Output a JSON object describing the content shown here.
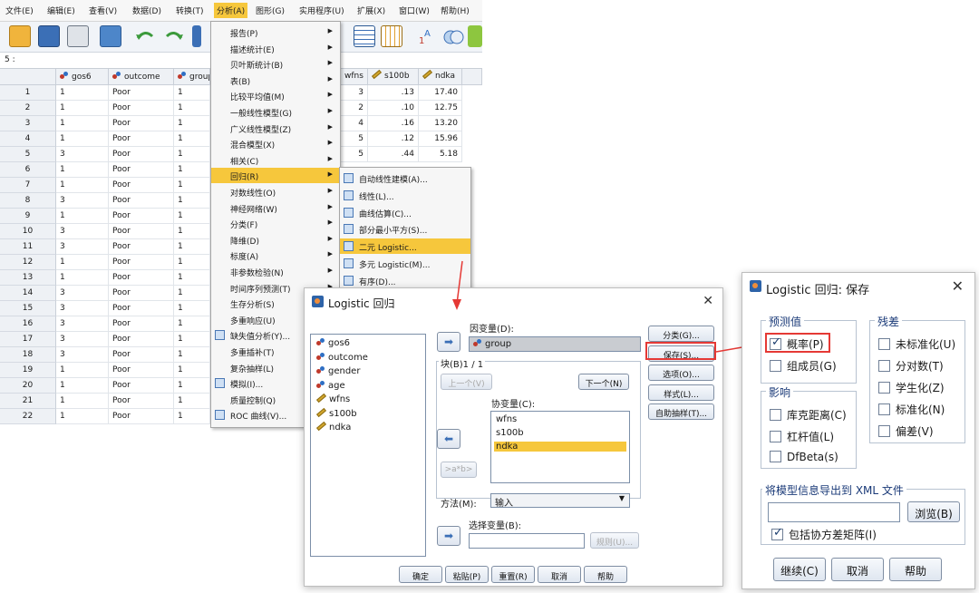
{
  "menubar": [
    "文件(E)",
    "编辑(E)",
    "查看(V)",
    "数据(D)",
    "转换(T)",
    "分析(A)",
    "图形(G)",
    "实用程序(U)",
    "扩展(X)",
    "窗口(W)",
    "帮助(H)"
  ],
  "active_menu": "分析(A)",
  "cell_ref": "5 :",
  "columns": [
    "gos6",
    "outcome",
    "group",
    "wfns",
    "s100b",
    "ndka"
  ],
  "rows": [
    {
      "n": "1",
      "gos6": "1",
      "outcome": "Poor",
      "group": "1",
      "wfns": "3",
      "s100b": ".13",
      "ndka": "17.40"
    },
    {
      "n": "2",
      "gos6": "1",
      "outcome": "Poor",
      "group": "1",
      "wfns": "2",
      "s100b": ".10",
      "ndka": "12.75"
    },
    {
      "n": "3",
      "gos6": "1",
      "outcome": "Poor",
      "group": "1",
      "wfns": "4",
      "s100b": ".16",
      "ndka": "13.20"
    },
    {
      "n": "4",
      "gos6": "1",
      "outcome": "Poor",
      "group": "1",
      "wfns": "5",
      "s100b": ".12",
      "ndka": "15.96"
    },
    {
      "n": "5",
      "gos6": "3",
      "outcome": "Poor",
      "group": "1",
      "wfns": "5",
      "s100b": ".44",
      "ndka": "5.18"
    },
    {
      "n": "6",
      "gos6": "1",
      "outcome": "Poor",
      "group": "1"
    },
    {
      "n": "7",
      "gos6": "1",
      "outcome": "Poor",
      "group": "1"
    },
    {
      "n": "8",
      "gos6": "3",
      "outcome": "Poor",
      "group": "1"
    },
    {
      "n": "9",
      "gos6": "1",
      "outcome": "Poor",
      "group": "1"
    },
    {
      "n": "10",
      "gos6": "3",
      "outcome": "Poor",
      "group": "1"
    },
    {
      "n": "11",
      "gos6": "3",
      "outcome": "Poor",
      "group": "1"
    },
    {
      "n": "12",
      "gos6": "1",
      "outcome": "Poor",
      "group": "1"
    },
    {
      "n": "13",
      "gos6": "1",
      "outcome": "Poor",
      "group": "1"
    },
    {
      "n": "14",
      "gos6": "3",
      "outcome": "Poor",
      "group": "1"
    },
    {
      "n": "15",
      "gos6": "3",
      "outcome": "Poor",
      "group": "1"
    },
    {
      "n": "16",
      "gos6": "3",
      "outcome": "Poor",
      "group": "1"
    },
    {
      "n": "17",
      "gos6": "3",
      "outcome": "Poor",
      "group": "1"
    },
    {
      "n": "18",
      "gos6": "3",
      "outcome": "Poor",
      "group": "1"
    },
    {
      "n": "19",
      "gos6": "1",
      "outcome": "Poor",
      "group": "1"
    },
    {
      "n": "20",
      "gos6": "1",
      "outcome": "Poor",
      "group": "1"
    },
    {
      "n": "21",
      "gos6": "1",
      "outcome": "Poor",
      "group": "1"
    },
    {
      "n": "22",
      "gos6": "1",
      "outcome": "Poor",
      "group": "1"
    }
  ],
  "analyze_menu": [
    {
      "label": "报告(P)",
      "sub": true
    },
    {
      "label": "描述统计(E)",
      "sub": true
    },
    {
      "label": "贝叶斯统计(B)",
      "sub": true
    },
    {
      "label": "表(B)",
      "sub": true
    },
    {
      "label": "比较平均值(M)",
      "sub": true
    },
    {
      "label": "一般线性模型(G)",
      "sub": true
    },
    {
      "label": "广义线性模型(Z)",
      "sub": true
    },
    {
      "label": "混合模型(X)",
      "sub": true
    },
    {
      "label": "相关(C)",
      "sub": true
    },
    {
      "label": "回归(R)",
      "sub": true,
      "highlight": true
    },
    {
      "label": "对数线性(O)",
      "sub": true
    },
    {
      "label": "神经网络(W)",
      "sub": true
    },
    {
      "label": "分类(F)",
      "sub": true
    },
    {
      "label": "降维(D)",
      "sub": true
    },
    {
      "label": "标度(A)",
      "sub": true
    },
    {
      "label": "非参数检验(N)",
      "sub": true
    },
    {
      "label": "时间序列预测(T)",
      "sub": true
    },
    {
      "label": "生存分析(S)",
      "sub": true
    },
    {
      "label": "多重响应(U)",
      "sub": true
    },
    {
      "label": "缺失值分析(Y)...",
      "icon": true
    },
    {
      "label": "多重插补(T)",
      "sub": true
    },
    {
      "label": "复杂抽样(L)",
      "sub": true
    },
    {
      "label": "模拟(I)...",
      "icon": true
    },
    {
      "label": "质量控制(Q)",
      "sub": true
    },
    {
      "label": "ROC 曲线(V)...",
      "icon": true
    }
  ],
  "regression_menu": [
    {
      "label": "自动线性建模(A)..."
    },
    {
      "label": "线性(L)..."
    },
    {
      "label": "曲线估算(C)..."
    },
    {
      "label": "部分最小平方(S)..."
    },
    {
      "label": "二元 Logistic...",
      "highlight": true
    },
    {
      "label": "多元 Logistic(M)..."
    },
    {
      "label": "有序(D)..."
    }
  ],
  "logistic_dialog": {
    "title": "Logistic 回归",
    "variables": [
      "gos6",
      "outcome",
      "gender",
      "age",
      "wfns",
      "s100b",
      "ndka"
    ],
    "dependent_label": "因变量(D):",
    "dependent_value": "group",
    "block_label": "块(B)1 / 1",
    "prev_label": "上一个(V)",
    "next_label": "下一个(N)",
    "covariates_label": "协变量(C):",
    "covariates": [
      "wfns",
      "s100b",
      "ndka"
    ],
    "interaction_label": ">a*b>",
    "method_label": "方法(M):",
    "method_value": "输入",
    "selection_label": "选择变量(B):",
    "rule_label": "规则(U)...",
    "side_buttons": [
      "分类(G)...",
      "保存(S)...",
      "选项(O)...",
      "样式(L)...",
      "自助抽样(T)..."
    ],
    "bottom_buttons": [
      "确定",
      "粘贴(P)",
      "重置(R)",
      "取消",
      "帮助"
    ]
  },
  "save_dialog": {
    "title": "Logistic 回归: 保存",
    "predicted_legend": "预测值",
    "predicted": [
      {
        "label": "概率(P)",
        "checked": true
      },
      {
        "label": "组成员(G)",
        "checked": false
      }
    ],
    "influence_legend": "影响",
    "influence": [
      {
        "label": "库克距离(C)"
      },
      {
        "label": "杠杆值(L)"
      },
      {
        "label": "DfBeta(s)"
      }
    ],
    "residuals_legend": "残差",
    "residuals": [
      {
        "label": "未标准化(U)"
      },
      {
        "label": "分对数(T)"
      },
      {
        "label": "学生化(Z)"
      },
      {
        "label": "标准化(N)"
      },
      {
        "label": "偏差(V)"
      }
    ],
    "export_legend": "将模型信息导出到 XML 文件",
    "browse_label": "浏览(B)",
    "include_cov_label": "包括协方差矩阵(I)",
    "include_cov_checked": true,
    "buttons": [
      "继续(C)",
      "取消",
      "帮助"
    ]
  },
  "colors": {
    "highlight": "#f6c73c",
    "arrow": "#e53935",
    "accent": "#1a3a78"
  }
}
